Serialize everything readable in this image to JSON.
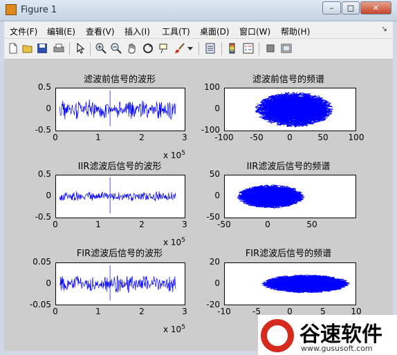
{
  "window": {
    "title": "Figure 1",
    "minimize": "–",
    "maximize": "□",
    "close": "✕"
  },
  "menubar": {
    "items": [
      "文件(F)",
      "编辑(E)",
      "查看(V)",
      "插入(I)",
      "工具(T)",
      "桌面(D)",
      "窗口(W)",
      "帮助(H)"
    ],
    "dock": "↘"
  },
  "toolbar": {
    "icons": [
      "new-figure-icon",
      "open-file-icon",
      "save-icon",
      "print-icon",
      "pointer-icon",
      "zoom-in-icon",
      "zoom-out-icon",
      "pan-hand-icon",
      "rotate-3d-icon",
      "data-cursor-icon",
      "brush-icon",
      "brush-dropdown-icon",
      "link-plot-icon",
      "colorbar-icon",
      "legend-icon",
      "hide-plot-tools-icon",
      "show-plot-tools-icon"
    ]
  },
  "colors": {
    "signal": "#0000ff",
    "background": "#cdcdcd",
    "axes": "#ffffff"
  },
  "axes": [
    {
      "title": "滤波前信号的波形",
      "yticks": [
        "0.5",
        "0",
        "-0.5"
      ],
      "xticks": [
        "0",
        "1",
        "2",
        "3"
      ],
      "exponent": "x 10",
      "exponent_power": "5"
    },
    {
      "title": "滤波前信号的频谱",
      "yticks": [
        "100",
        "0",
        "-100"
      ],
      "xticks": [
        "-100",
        "-50",
        "0",
        "50",
        "100"
      ]
    },
    {
      "title": "IIR滤波后信号的波形",
      "yticks": [
        "0.5",
        "0",
        "-0.5"
      ],
      "xticks": [
        "0",
        "1",
        "2",
        "3"
      ],
      "exponent": "x 10",
      "exponent_power": "5"
    },
    {
      "title": "IIR滤波后信号的频谱",
      "yticks": [
        "50",
        "0",
        "-50"
      ],
      "xticks": [
        "-50",
        "0",
        "50"
      ]
    },
    {
      "title": "FIR滤波后信号的波形",
      "yticks": [
        "0.05",
        "0",
        "-0.05"
      ],
      "xticks": [
        "0",
        "1",
        "2",
        "3"
      ],
      "exponent": "x 10",
      "exponent_power": "5"
    },
    {
      "title": "FIR滤波后信号的频谱",
      "yticks": [
        "20",
        "0",
        "-20"
      ],
      "xticks": [
        "-10",
        "-5",
        "0",
        "5",
        "10"
      ]
    }
  ],
  "watermark": {
    "brand": "谷速软件",
    "url": "www.gususoft.com"
  }
}
